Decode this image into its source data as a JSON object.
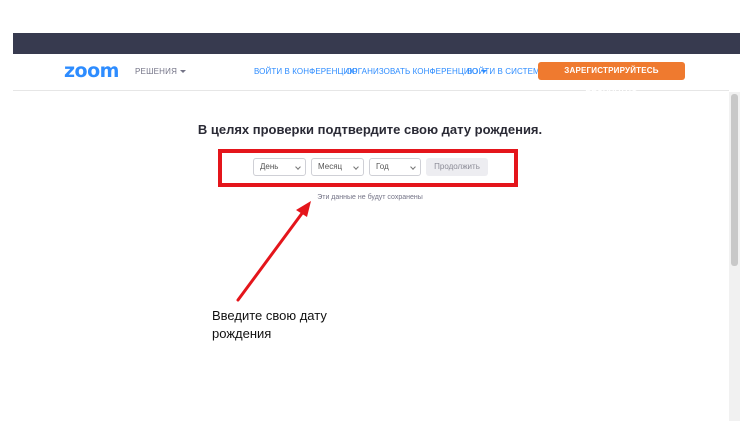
{
  "header": {
    "logo": "zoom",
    "solutions": "РЕШЕНИЯ",
    "nav": {
      "join": "ВОЙТИ В КОНФЕРЕНЦИЮ",
      "host": "ОРГАНИЗОВАТЬ КОНФЕРЕНЦИЮ",
      "signin": "ВОЙТИ В СИСТЕМУ"
    },
    "signup": "ЗАРЕГИСТРИРУЙТЕСЬ БЕСПЛАТНО"
  },
  "main": {
    "heading": "В целях проверки подтвердите свою дату рождения.",
    "day": "День",
    "month": "Месяц",
    "year": "Год",
    "continue": "Продолжить",
    "note": "Эти данные не будут сохранены"
  },
  "annotation": {
    "line1": "Введите свою дату",
    "line2": "рождения"
  },
  "colors": {
    "brand": "#2d8cff",
    "signup": "#ef7a2f",
    "highlight": "#e4151b",
    "topbar": "#373a4f"
  }
}
